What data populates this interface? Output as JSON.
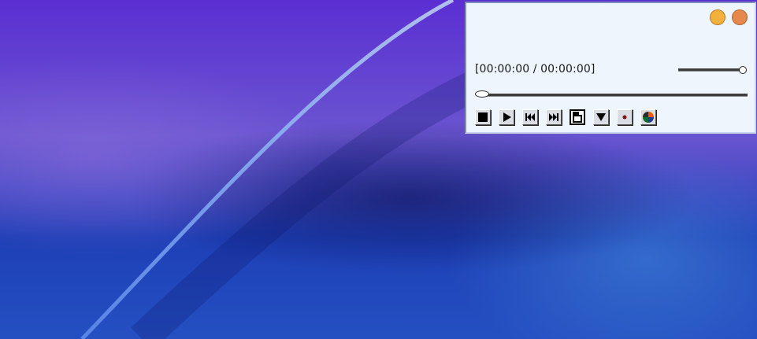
{
  "desktop": {
    "wallpaper": "blue-violet-abstract",
    "colors": {
      "top": "#5b2fd2",
      "bottom": "#2450c2",
      "streak": "#8fb0f0"
    }
  },
  "player": {
    "window_buttons": [
      {
        "name": "minimize",
        "color": "#f2b13d"
      },
      {
        "name": "close",
        "color": "#e4884e"
      }
    ],
    "time": {
      "current": "00:00:00",
      "total": "00:00:00",
      "display": "[00:00:00 / 00:00:00]"
    },
    "volume_level": 1.0,
    "seek_position": 0.0,
    "controls": [
      {
        "name": "stop",
        "icon": "stop-icon"
      },
      {
        "name": "play",
        "icon": "play-icon"
      },
      {
        "name": "rewind",
        "icon": "rewind-icon"
      },
      {
        "name": "fast-forward",
        "icon": "fast-forward-icon"
      },
      {
        "name": "open-file",
        "icon": "file-icon"
      },
      {
        "name": "menu",
        "icon": "down-triangle-icon"
      },
      {
        "name": "record",
        "icon": "record-dot-icon"
      },
      {
        "name": "color-settings",
        "icon": "color-wheel-icon"
      }
    ]
  }
}
